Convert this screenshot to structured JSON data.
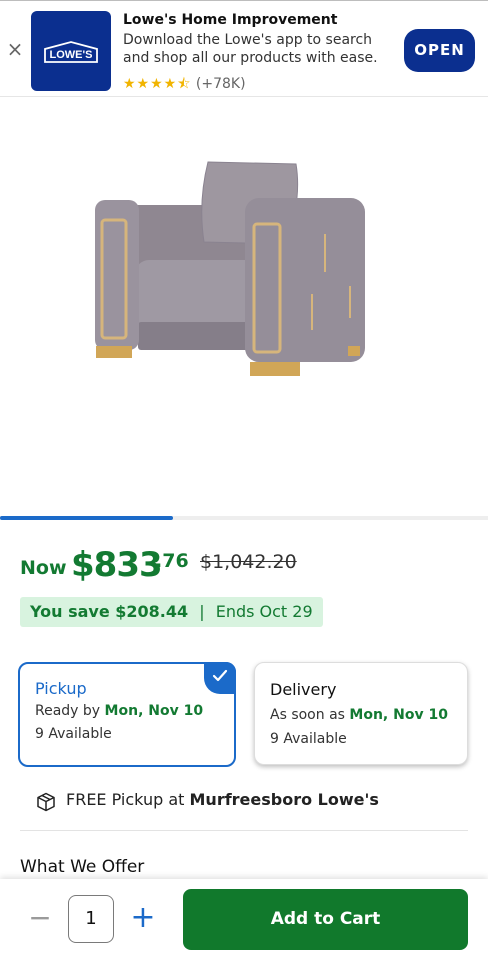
{
  "app_banner": {
    "close_glyph": "×",
    "logo_text": "LOWE'S",
    "title": "Lowe's Home Improvement",
    "description": "Download the Lowe's app to search and shop all our products with ease.",
    "stars": "★★★★⯪",
    "rating_count": "(+78K)",
    "open_label": "OPEN",
    "brand_color": "#0b2f8f"
  },
  "carousel": {
    "progress": 0.355
  },
  "price": {
    "now_label": "Now",
    "dollars": "$833",
    "cents": ".76",
    "was": "$1,042.20",
    "save_text": "You save $208.44",
    "separator": "|",
    "ends_text": "Ends Oct 29",
    "accent_color": "#137a32"
  },
  "fulfillment": {
    "pickup": {
      "title": "Pickup",
      "ready_prefix": "Ready by",
      "ready_date": "Mon, Nov 10",
      "availability": "9 Available",
      "selected": true
    },
    "delivery": {
      "title": "Delivery",
      "eta_prefix": "As soon as",
      "eta_date": "Mon, Nov 10",
      "availability": "9 Available",
      "selected": false
    }
  },
  "store_pickup": {
    "prefix": "FREE Pickup at",
    "store": "Murfreesboro Lowe's",
    "icon": "box-icon"
  },
  "sections": {
    "what_we_offer": "What We Offer"
  },
  "cart_bar": {
    "minus": "−",
    "quantity": "1",
    "plus": "+",
    "add_label": "Add to Cart",
    "button_color": "#11792c"
  }
}
